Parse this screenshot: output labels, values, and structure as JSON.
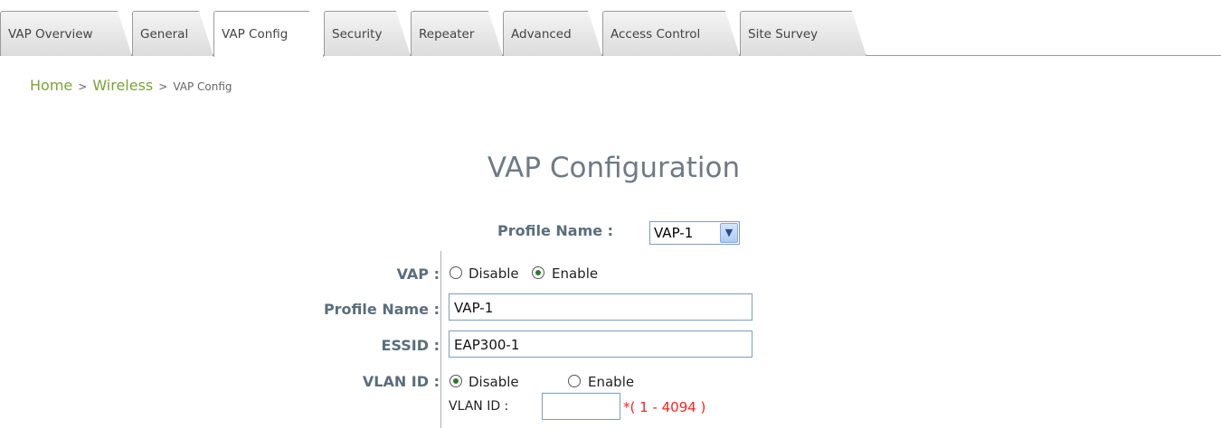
{
  "tabs": [
    {
      "label": "VAP Overview"
    },
    {
      "label": "General"
    },
    {
      "label": "VAP Config"
    },
    {
      "label": "Security"
    },
    {
      "label": "Repeater"
    },
    {
      "label": "Advanced"
    },
    {
      "label": "Access Control"
    },
    {
      "label": "Site Survey"
    }
  ],
  "active_tab": "VAP Config",
  "breadcrumb": {
    "home": "Home",
    "sep1": ">",
    "section": "Wireless",
    "sep2": ">",
    "current": "VAP Config"
  },
  "page_title": "VAP Configuration",
  "profile_select": {
    "label": "Profile Name :",
    "value": "VAP-1"
  },
  "form": {
    "vap": {
      "label": "VAP :",
      "option_disable": "Disable",
      "option_enable": "Enable",
      "selected": "Enable"
    },
    "profile_name": {
      "label": "Profile Name :",
      "value": "VAP-1"
    },
    "essid": {
      "label": "ESSID :",
      "value": "EAP300-1"
    },
    "vlan": {
      "label": "VLAN ID :",
      "option_disable": "Disable",
      "option_enable": "Enable",
      "selected": "Disable",
      "id_label": "VLAN ID :",
      "id_value": "",
      "hint": "*( 1 - 4094 )"
    }
  },
  "colors": {
    "link": "#7aa33a",
    "title": "#6d7b85",
    "label": "#5a6e7c",
    "hint": "#ff2020"
  }
}
